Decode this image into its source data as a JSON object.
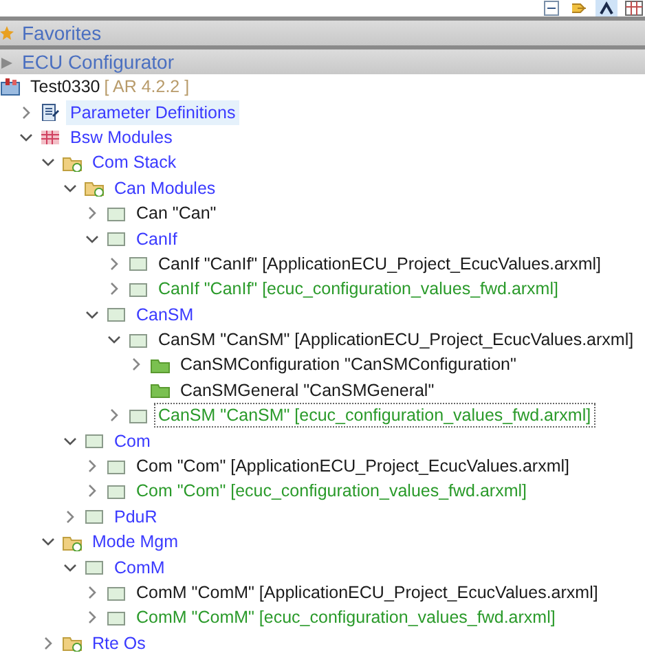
{
  "toolbar": {
    "buttons": [
      {
        "kind": "collapse",
        "selected": false
      },
      {
        "kind": "link",
        "selected": false
      },
      {
        "kind": "filter",
        "selected": true
      },
      {
        "kind": "layout",
        "selected": false
      }
    ]
  },
  "sections": [
    {
      "kind": "favorites",
      "title": "Favorites"
    },
    {
      "kind": "configurator",
      "title": "ECU Configurator"
    }
  ],
  "tree": [
    {
      "kind": "project",
      "label": "Test0330",
      "suffix": "[ AR 4.2.2 ]",
      "color": "#1a1a1a",
      "selected": false,
      "focused": false,
      "children": [
        {
          "kind": "definitions",
          "label": "Parameter Definitions",
          "color": "#3a3aff",
          "expanded": false,
          "selected": true,
          "focused": false
        },
        {
          "kind": "bsw",
          "label": "Bsw Modules",
          "color": "#3a3aff",
          "expanded": true,
          "selected": false,
          "focused": false,
          "children": [
            {
              "kind": "folder",
              "label": "Com Stack",
              "color": "#3a3aff",
              "expanded": true,
              "selected": false,
              "focused": false,
              "children": [
                {
                  "kind": "folder",
                  "label": "Can Modules",
                  "color": "#3a3aff",
                  "expanded": true,
                  "selected": false,
                  "focused": false,
                  "children": [
                    {
                      "kind": "module",
                      "label": "Can \"Can\"",
                      "color": "#1a1a1a",
                      "expanded": false,
                      "selected": false,
                      "focused": false
                    },
                    {
                      "kind": "module",
                      "label": "CanIf",
                      "color": "#3a3aff",
                      "expanded": true,
                      "selected": false,
                      "focused": false,
                      "children": [
                        {
                          "kind": "module",
                          "label": "CanIf \"CanIf\" [ApplicationECU_Project_EcucValues.arxml]",
                          "color": "#1a1a1a",
                          "expanded": false,
                          "selected": false,
                          "focused": false
                        },
                        {
                          "kind": "module",
                          "label": "CanIf \"CanIf\" [ecuc_configuration_values_fwd.arxml]",
                          "color": "#2a9a2a",
                          "expanded": false,
                          "selected": false,
                          "focused": false
                        }
                      ]
                    },
                    {
                      "kind": "module",
                      "label": "CanSM",
                      "color": "#3a3aff",
                      "expanded": true,
                      "selected": false,
                      "focused": false,
                      "children": [
                        {
                          "kind": "module",
                          "label": "CanSM \"CanSM\" [ApplicationECU_Project_EcucValues.arxml]",
                          "color": "#1a1a1a",
                          "expanded": true,
                          "selected": false,
                          "focused": false,
                          "children": [
                            {
                              "kind": "container",
                              "label": "CanSMConfiguration \"CanSMConfiguration\"",
                              "color": "#1a1a1a",
                              "expanded": false,
                              "selected": false,
                              "focused": false
                            },
                            {
                              "kind": "container",
                              "label": "CanSMGeneral \"CanSMGeneral\"",
                              "color": "#1a1a1a",
                              "selected": false,
                              "focused": false
                            }
                          ]
                        },
                        {
                          "kind": "module",
                          "label": "CanSM \"CanSM\" [ecuc_configuration_values_fwd.arxml]",
                          "color": "#2a9a2a",
                          "expanded": false,
                          "selected": false,
                          "focused": true
                        }
                      ]
                    }
                  ]
                },
                {
                  "kind": "module",
                  "label": "Com",
                  "color": "#3a3aff",
                  "expanded": true,
                  "selected": false,
                  "focused": false,
                  "children": [
                    {
                      "kind": "module",
                      "label": "Com \"Com\" [ApplicationECU_Project_EcucValues.arxml]",
                      "color": "#1a1a1a",
                      "expanded": false,
                      "selected": false,
                      "focused": false
                    },
                    {
                      "kind": "module",
                      "label": "Com \"Com\" [ecuc_configuration_values_fwd.arxml]",
                      "color": "#2a9a2a",
                      "expanded": false,
                      "selected": false,
                      "focused": false
                    }
                  ]
                },
                {
                  "kind": "module",
                  "label": "PduR",
                  "color": "#3a3aff",
                  "expanded": false,
                  "selected": false,
                  "focused": false
                }
              ]
            },
            {
              "kind": "folder",
              "label": "Mode Mgm",
              "color": "#3a3aff",
              "expanded": true,
              "selected": false,
              "focused": false,
              "children": [
                {
                  "kind": "module",
                  "label": "ComM",
                  "color": "#3a3aff",
                  "expanded": true,
                  "selected": false,
                  "focused": false,
                  "children": [
                    {
                      "kind": "module",
                      "label": "ComM \"ComM\" [ApplicationECU_Project_EcucValues.arxml]",
                      "color": "#1a1a1a",
                      "expanded": false,
                      "selected": false,
                      "focused": false
                    },
                    {
                      "kind": "module",
                      "label": "ComM \"ComM\" [ecuc_configuration_values_fwd.arxml]",
                      "color": "#2a9a2a",
                      "expanded": false,
                      "selected": false,
                      "focused": false
                    }
                  ]
                }
              ]
            },
            {
              "kind": "folder",
              "label": "Rte Os",
              "color": "#3a3aff",
              "expanded": false,
              "selected": false,
              "focused": false
            }
          ]
        }
      ]
    }
  ]
}
